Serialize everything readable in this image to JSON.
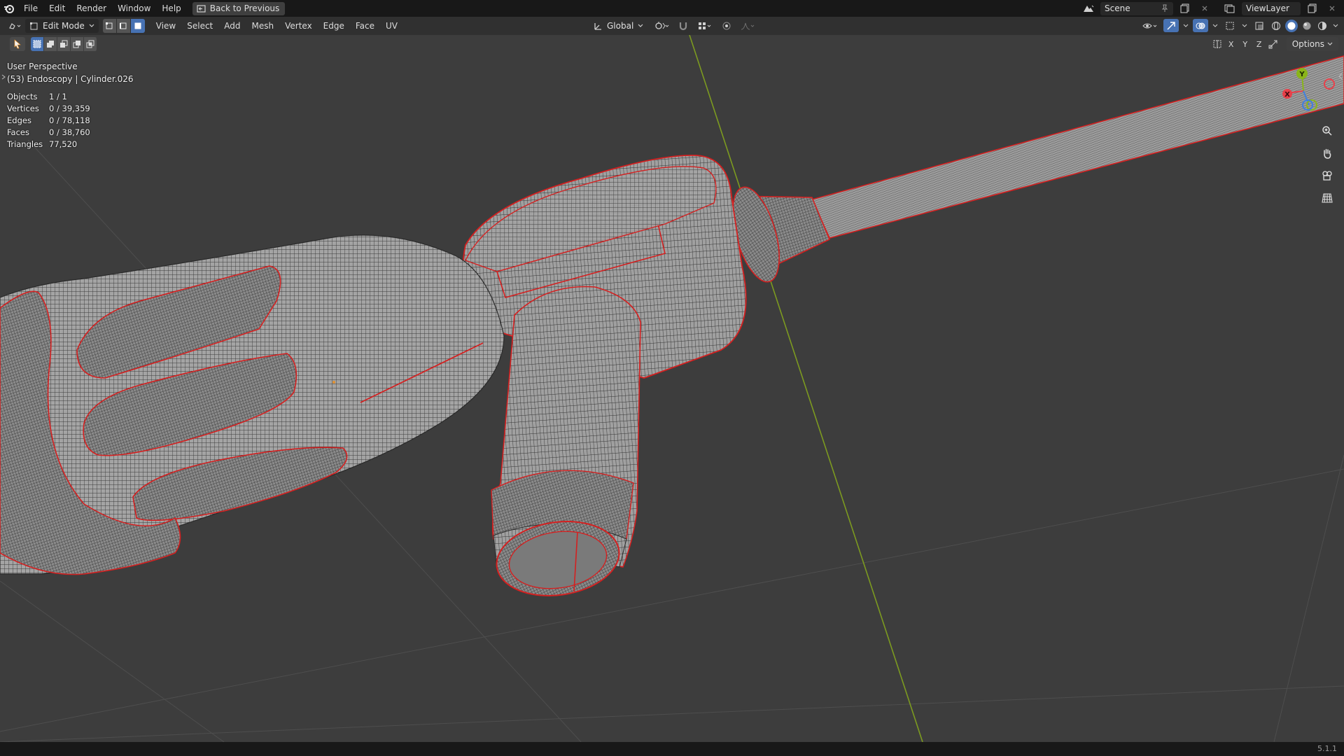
{
  "topbar": {
    "menus": [
      "File",
      "Edit",
      "Render",
      "Window",
      "Help"
    ],
    "back_label": "Back to Previous",
    "scene_name": "Scene",
    "view_layer": "ViewLayer"
  },
  "header": {
    "mode": "Edit Mode",
    "menus": [
      "View",
      "Select",
      "Add",
      "Mesh",
      "Vertex",
      "Edge",
      "Face",
      "UV"
    ],
    "transform_orientation": "Global"
  },
  "toolrow": {
    "axes": [
      "X",
      "Y",
      "Z"
    ],
    "options_label": "Options"
  },
  "viewport": {
    "perspective": "User Perspective",
    "object_info": "(53) Endoscopy | Cylinder.026",
    "stats": [
      {
        "label": "Objects",
        "value": "1 / 1"
      },
      {
        "label": "Vertices",
        "value": "0 / 39,359"
      },
      {
        "label": "Edges",
        "value": "0 / 78,118"
      },
      {
        "label": "Faces",
        "value": "0 / 38,760"
      },
      {
        "label": "Triangles",
        "value": "77,520"
      }
    ],
    "gizmo": {
      "y": "Y",
      "x": "X"
    }
  },
  "statusbar": {
    "version": "5.1.1"
  },
  "colors": {
    "accent": "#4772b3",
    "seam": "#d42020",
    "axis_y": "#8ab51a",
    "axis_x": "#e8404a",
    "axis_z": "#3f7fe0"
  }
}
